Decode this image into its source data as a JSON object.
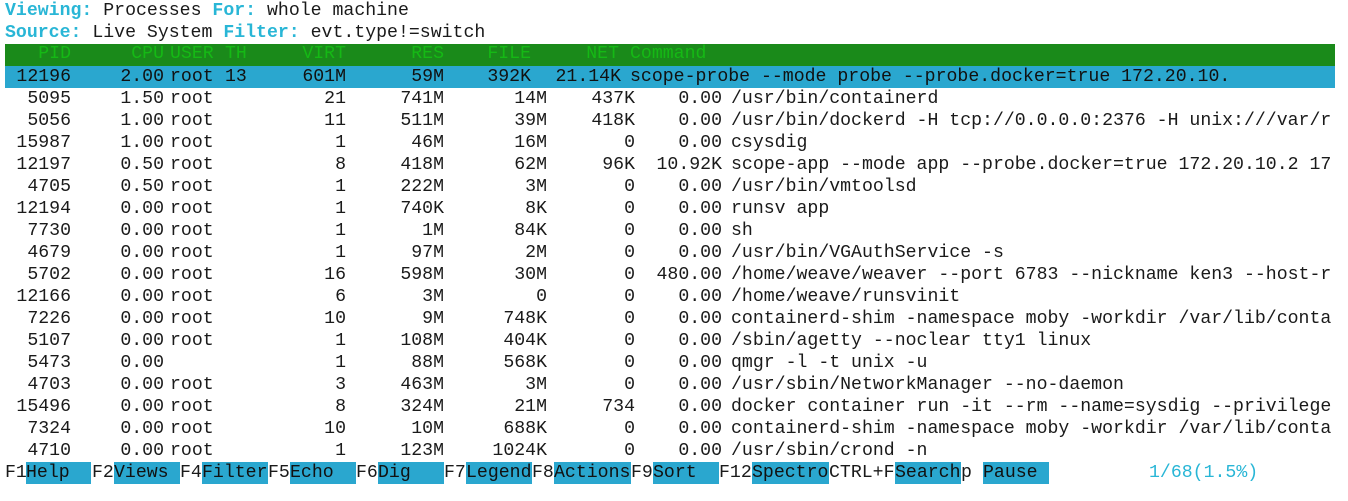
{
  "top": {
    "viewing_label": "Viewing:",
    "viewing_value": "Processes",
    "for_label": "For:",
    "for_value": "whole machine",
    "source_label": "Source:",
    "source_value": "Live System",
    "filter_label": "Filter:",
    "filter_value": "evt.type!=switch"
  },
  "columns": [
    "PID",
    "CPU",
    "USER",
    "TH",
    "VIRT",
    "RES",
    "FILE",
    "NET",
    "Command"
  ],
  "rows": [
    {
      "pid": "12196",
      "cpu": "2.00",
      "user": "root",
      "th": "13",
      "virt": "601M",
      "res": "59M",
      "file": "392K",
      "net": "21.14K",
      "cmd": "scope-probe --mode probe --probe.docker=true 172.20.10."
    },
    {
      "pid": "5095",
      "cpu": "1.50",
      "user": "root",
      "th": "21",
      "virt": "741M",
      "res": "14M",
      "file": "437K",
      "net": "0.00",
      "cmd": "/usr/bin/containerd"
    },
    {
      "pid": "5056",
      "cpu": "1.00",
      "user": "root",
      "th": "11",
      "virt": "511M",
      "res": "39M",
      "file": "418K",
      "net": "0.00",
      "cmd": "/usr/bin/dockerd -H tcp://0.0.0.0:2376 -H unix:///var/r"
    },
    {
      "pid": "15987",
      "cpu": "1.00",
      "user": "root",
      "th": "1",
      "virt": "46M",
      "res": "16M",
      "file": "0",
      "net": "0.00",
      "cmd": "csysdig"
    },
    {
      "pid": "12197",
      "cpu": "0.50",
      "user": "root",
      "th": "8",
      "virt": "418M",
      "res": "62M",
      "file": "96K",
      "net": "10.92K",
      "cmd": "scope-app --mode app --probe.docker=true 172.20.10.2 17"
    },
    {
      "pid": "4705",
      "cpu": "0.50",
      "user": "root",
      "th": "1",
      "virt": "222M",
      "res": "3M",
      "file": "0",
      "net": "0.00",
      "cmd": "/usr/bin/vmtoolsd"
    },
    {
      "pid": "12194",
      "cpu": "0.00",
      "user": "root",
      "th": "1",
      "virt": "740K",
      "res": "8K",
      "file": "0",
      "net": "0.00",
      "cmd": "runsv app"
    },
    {
      "pid": "7730",
      "cpu": "0.00",
      "user": "root",
      "th": "1",
      "virt": "1M",
      "res": "84K",
      "file": "0",
      "net": "0.00",
      "cmd": "sh"
    },
    {
      "pid": "4679",
      "cpu": "0.00",
      "user": "root",
      "th": "1",
      "virt": "97M",
      "res": "2M",
      "file": "0",
      "net": "0.00",
      "cmd": "/usr/bin/VGAuthService -s"
    },
    {
      "pid": "5702",
      "cpu": "0.00",
      "user": "root",
      "th": "16",
      "virt": "598M",
      "res": "30M",
      "file": "0",
      "net": "480.00",
      "cmd": "/home/weave/weaver --port 6783 --nickname ken3 --host-r"
    },
    {
      "pid": "12166",
      "cpu": "0.00",
      "user": "root",
      "th": "6",
      "virt": "3M",
      "res": "0",
      "file": "0",
      "net": "0.00",
      "cmd": "/home/weave/runsvinit"
    },
    {
      "pid": "7226",
      "cpu": "0.00",
      "user": "root",
      "th": "10",
      "virt": "9M",
      "res": "748K",
      "file": "0",
      "net": "0.00",
      "cmd": "containerd-shim -namespace moby -workdir /var/lib/conta"
    },
    {
      "pid": "5107",
      "cpu": "0.00",
      "user": "root",
      "th": "1",
      "virt": "108M",
      "res": "404K",
      "file": "0",
      "net": "0.00",
      "cmd": "/sbin/agetty --noclear tty1 linux"
    },
    {
      "pid": "5473",
      "cpu": "0.00",
      "user": "",
      "th": "1",
      "virt": "88M",
      "res": "568K",
      "file": "0",
      "net": "0.00",
      "cmd": "qmgr -l -t unix -u"
    },
    {
      "pid": "4703",
      "cpu": "0.00",
      "user": "root",
      "th": "3",
      "virt": "463M",
      "res": "3M",
      "file": "0",
      "net": "0.00",
      "cmd": "/usr/sbin/NetworkManager --no-daemon"
    },
    {
      "pid": "15496",
      "cpu": "0.00",
      "user": "root",
      "th": "8",
      "virt": "324M",
      "res": "21M",
      "file": "734",
      "net": "0.00",
      "cmd": "docker container run -it --rm --name=sysdig --privilege"
    },
    {
      "pid": "7324",
      "cpu": "0.00",
      "user": "root",
      "th": "10",
      "virt": "10M",
      "res": "688K",
      "file": "0",
      "net": "0.00",
      "cmd": "containerd-shim -namespace moby -workdir /var/lib/conta"
    },
    {
      "pid": "4710",
      "cpu": "0.00",
      "user": "root",
      "th": "1",
      "virt": "123M",
      "res": "1024K",
      "file": "0",
      "net": "0.00",
      "cmd": "/usr/sbin/crond -n"
    }
  ],
  "footer": {
    "keys": [
      {
        "key": "F1",
        "label": "Help"
      },
      {
        "key": "F2",
        "label": "Views"
      },
      {
        "key": "F4",
        "label": "Filter"
      },
      {
        "key": "F5",
        "label": "Echo"
      },
      {
        "key": "F6",
        "label": "Dig"
      },
      {
        "key": "F7",
        "label": "Legend"
      },
      {
        "key": "F8",
        "label": "Actions"
      },
      {
        "key": "F9",
        "label": "Sort"
      },
      {
        "key": "F12",
        "label": "Spectro"
      },
      {
        "key": "CTRL+F",
        "label": "Search"
      },
      {
        "key": "p",
        "label": "Pause"
      }
    ],
    "count": "1/68(1.5%)"
  },
  "colors": {
    "accent": "#29b6d6",
    "header_bg": "#1a8a1a",
    "header_text": "#15b915",
    "selected_bg": "#2aa7cf"
  }
}
